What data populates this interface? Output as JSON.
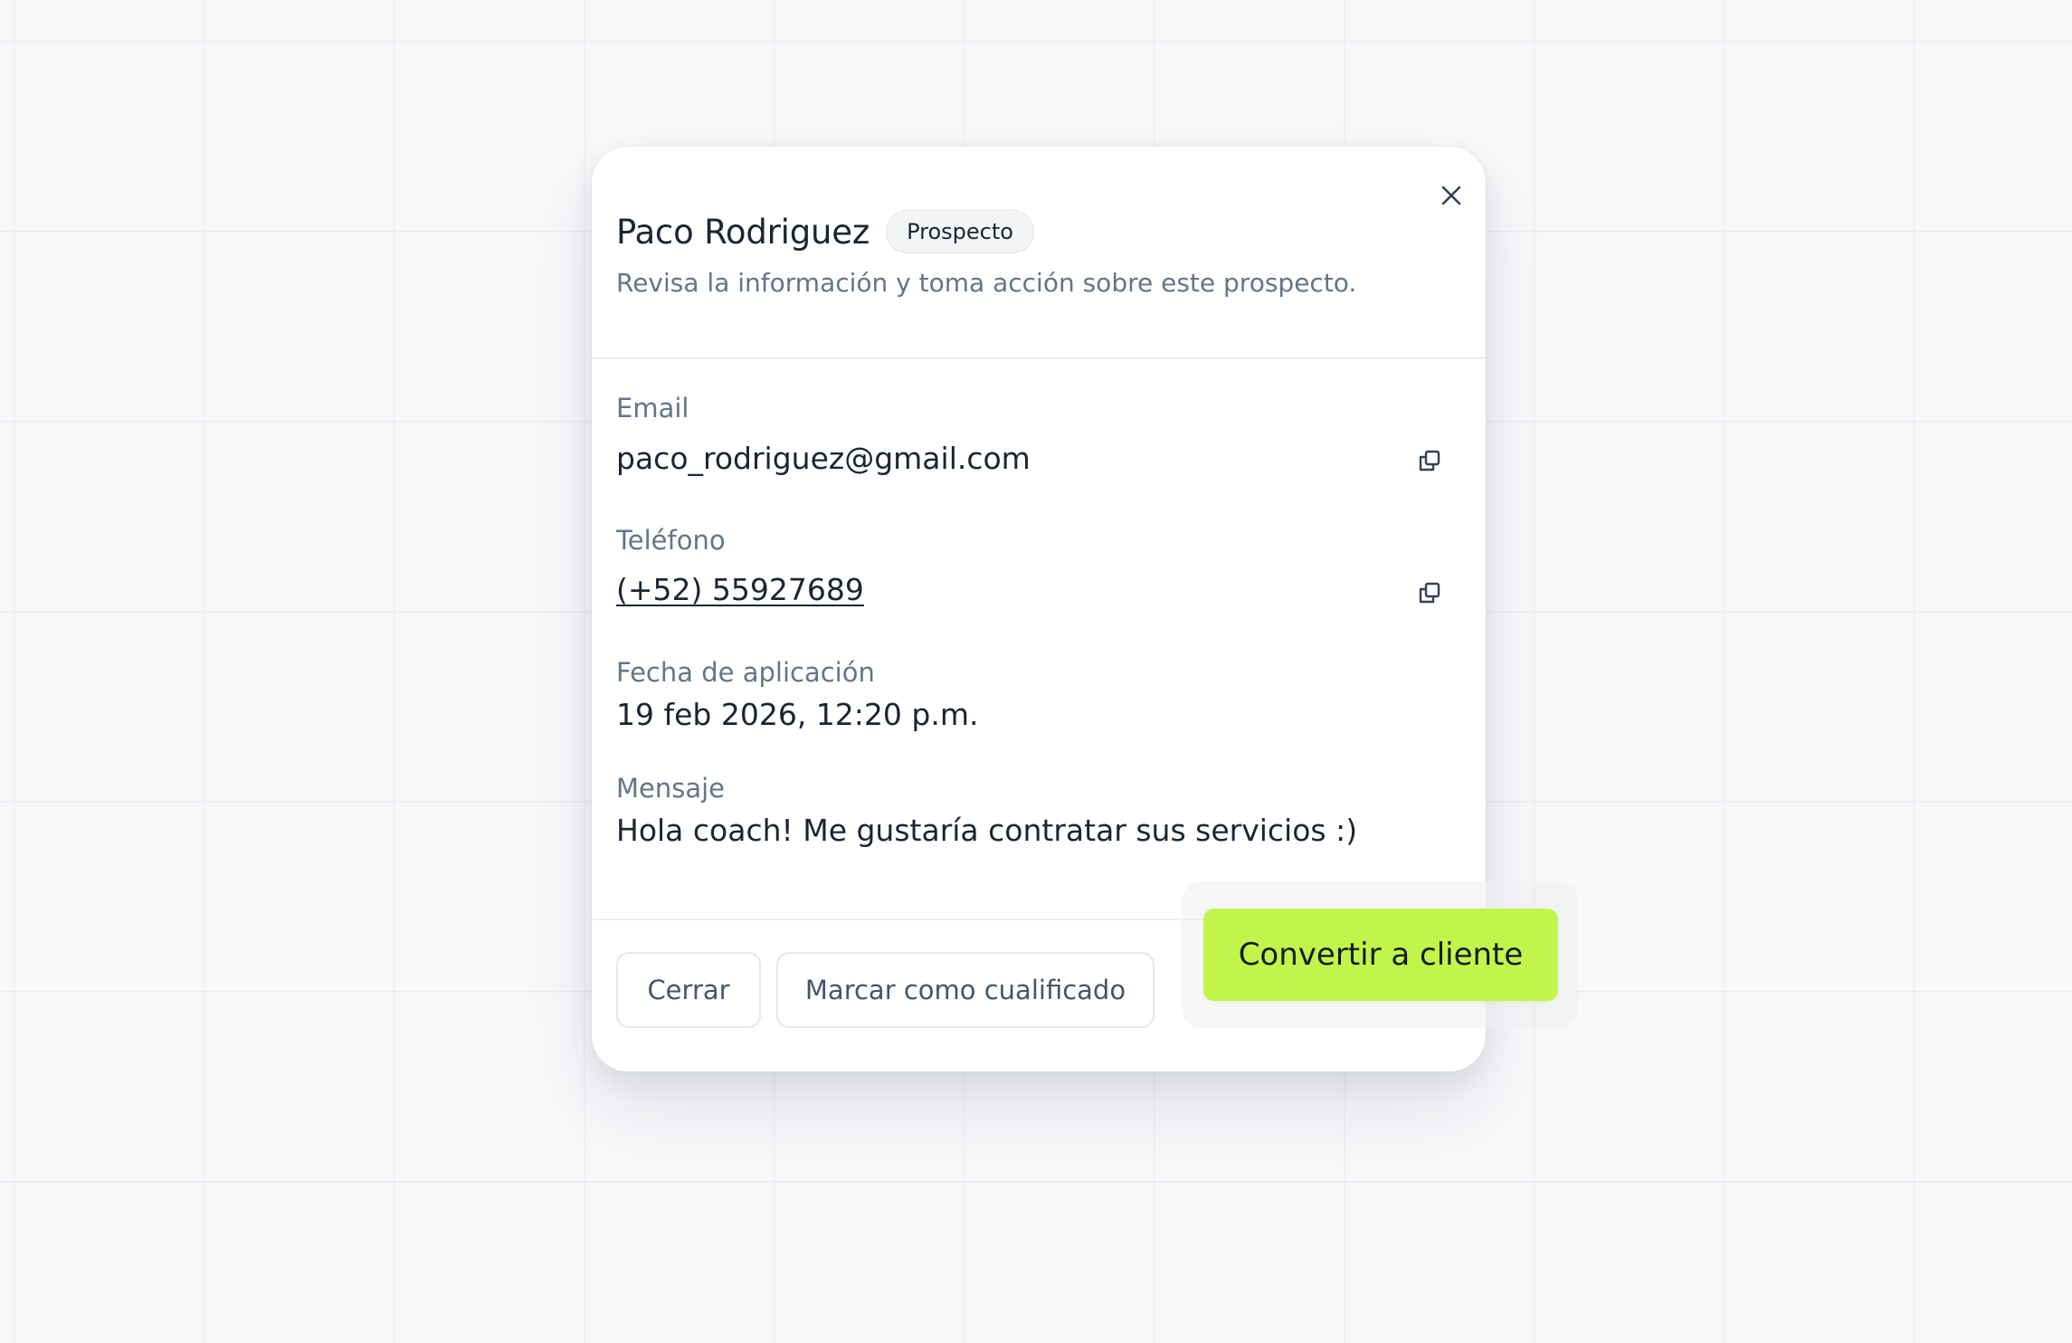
{
  "lead": {
    "name": "Paco Rodriguez",
    "status_badge": "Prospecto",
    "subtitle": "Revisa la información y toma acción sobre este prospecto."
  },
  "fields": {
    "email": {
      "label": "Email",
      "value": "paco_rodriguez@gmail.com"
    },
    "phone": {
      "label": "Teléfono",
      "value": "(+52) 55927689"
    },
    "application_date": {
      "label": "Fecha de aplicación",
      "value": "19 feb 2026, 12:20 p.m."
    },
    "message": {
      "label": "Mensaje",
      "value": "Hola coach! Me gustaría contratar sus servicios :)"
    }
  },
  "actions": {
    "close_label": "Cerrar",
    "qualify_label": "Marcar como cualificado",
    "convert_label": "Convertir a cliente"
  },
  "icons": {
    "close": "close-icon",
    "copy": "copy-icon"
  },
  "colors": {
    "accent": "#c2f54a",
    "text_primary": "#1b2533",
    "text_muted": "#64748b",
    "background": "#f7f8fa"
  }
}
